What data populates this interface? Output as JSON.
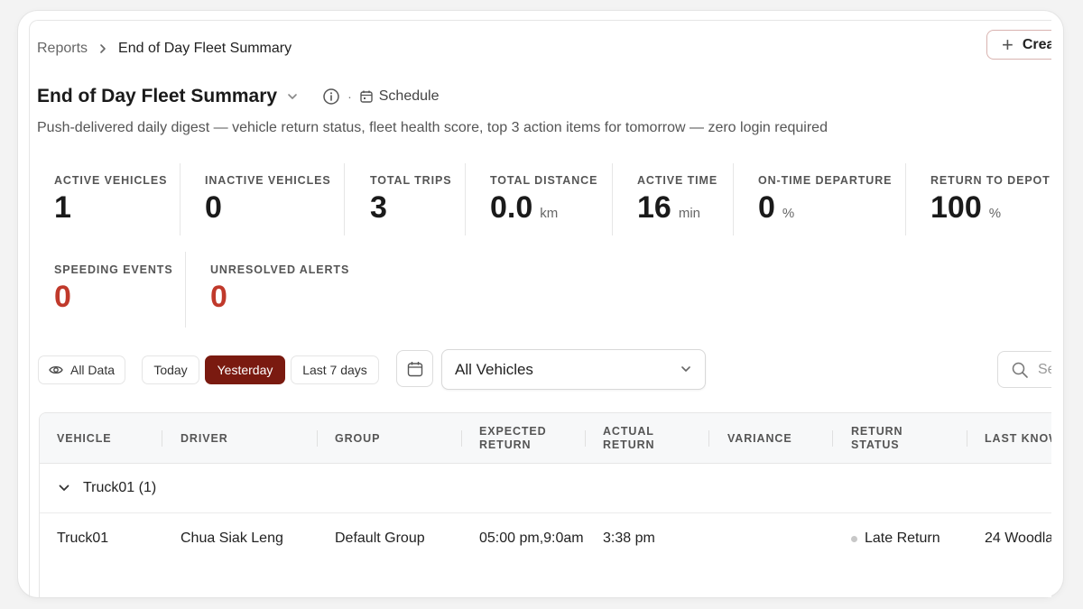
{
  "breadcrumb": {
    "parent": "Reports",
    "current": "End of Day Fleet Summary"
  },
  "create_button": {
    "label": "Crea"
  },
  "header": {
    "title": "End of Day Fleet Summary",
    "schedule_label": "Schedule",
    "subtitle": "Push-delivered daily digest — vehicle return status, fleet health score, top 3 action items for tomorrow — zero login required"
  },
  "metrics": [
    {
      "label": "ACTIVE VEHICLES",
      "value": "1",
      "unit": ""
    },
    {
      "label": "INACTIVE VEHICLES",
      "value": "0",
      "unit": ""
    },
    {
      "label": "TOTAL TRIPS",
      "value": "3",
      "unit": ""
    },
    {
      "label": "TOTAL DISTANCE",
      "value": "0.0",
      "unit": "km"
    },
    {
      "label": "ACTIVE TIME",
      "value": "16",
      "unit": "min"
    },
    {
      "label": "ON-TIME DEPARTURE",
      "value": "0",
      "unit": "%"
    },
    {
      "label": "RETURN TO DEPOT",
      "value": "100",
      "unit": "%"
    },
    {
      "label": "SPEEDING EVENTS",
      "value": "0",
      "unit": ""
    },
    {
      "label": "UNRESOLVED ALERTS",
      "value": "0",
      "unit": ""
    }
  ],
  "filters": {
    "all_data": "All Data",
    "today": "Today",
    "yesterday": "Yesterday",
    "last7": "Last 7 days",
    "selected_range": "Yesterday",
    "vehicle_select": "All Vehicles",
    "search_placeholder": "Se"
  },
  "table": {
    "columns": [
      "VEHICLE",
      "DRIVER",
      "GROUP",
      "EXPECTED RETURN",
      "ACTUAL RETURN",
      "VARIANCE",
      "RETURN STATUS",
      "LAST KNOW"
    ],
    "group": {
      "label": "Truck01 (1)"
    },
    "rows": [
      {
        "vehicle": "Truck01",
        "driver": "Chua Siak Leng",
        "group": "Default Group",
        "expected_return": "05:00 pm,9:0am",
        "actual_return": "3:38 pm",
        "variance": "",
        "return_status": "Late Return",
        "last_known": "24 Woodla"
      }
    ]
  },
  "colors": {
    "accent": "#7a1a10",
    "alert_red": "#c0392b"
  }
}
